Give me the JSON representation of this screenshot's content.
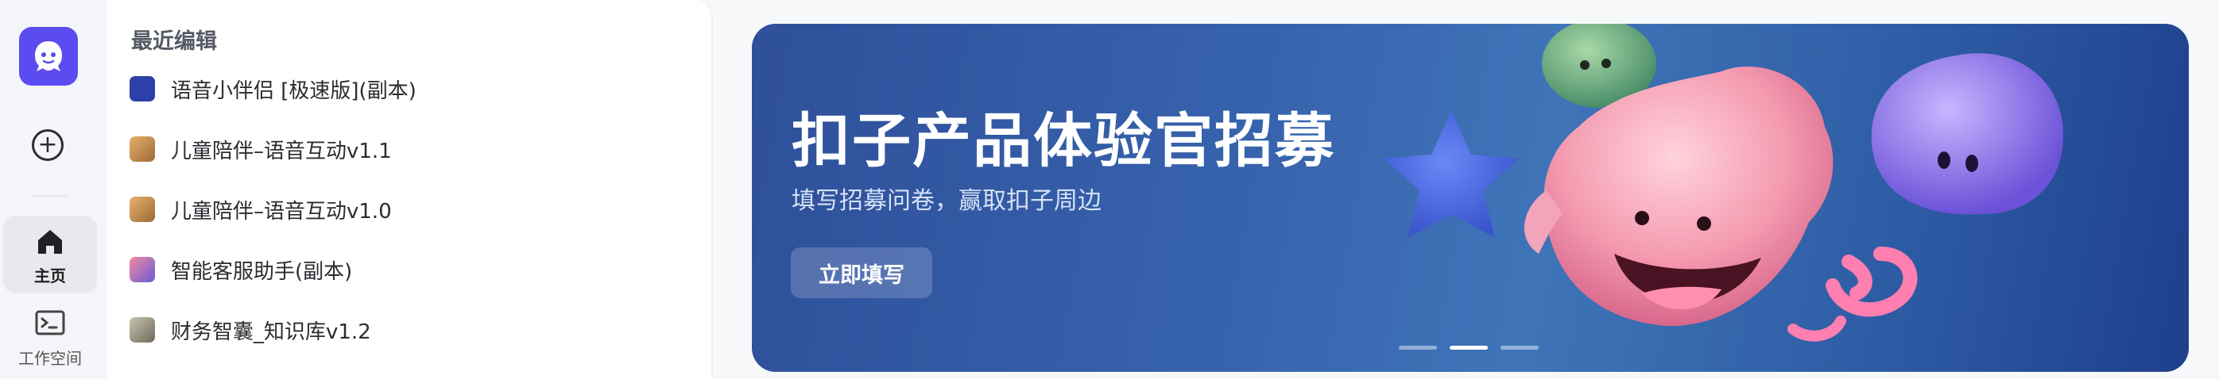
{
  "sidebar": {
    "nav": [
      {
        "label": "主页",
        "icon": "home-icon",
        "active": true
      },
      {
        "label": "工作空间",
        "icon": "terminal-icon",
        "active": false
      }
    ]
  },
  "recent": {
    "title": "最近编辑",
    "items": [
      {
        "label": "语音小伴侣 [极速版](副本)",
        "thumb_color": "#2d3fa8"
      },
      {
        "label": "儿童陪伴–语音互动v1.1",
        "thumb_color": "#c98a3d"
      },
      {
        "label": "儿童陪伴–语音互动v1.0",
        "thumb_color": "#c98a3d"
      },
      {
        "label": "智能客服助手(副本)",
        "thumb_color": "#6b5bd6"
      },
      {
        "label": "财务智囊_知识库v1.2",
        "thumb_color": "#8a8a7a"
      }
    ]
  },
  "banner": {
    "title": "扣子产品体验官招募",
    "subtitle": "填写招募问卷，赢取扣子周边",
    "cta": "立即填写",
    "slides_total": 3,
    "slide_active": 2
  },
  "colors": {
    "brand": "#5a4cf0",
    "banner_bg": "#3763ad"
  }
}
